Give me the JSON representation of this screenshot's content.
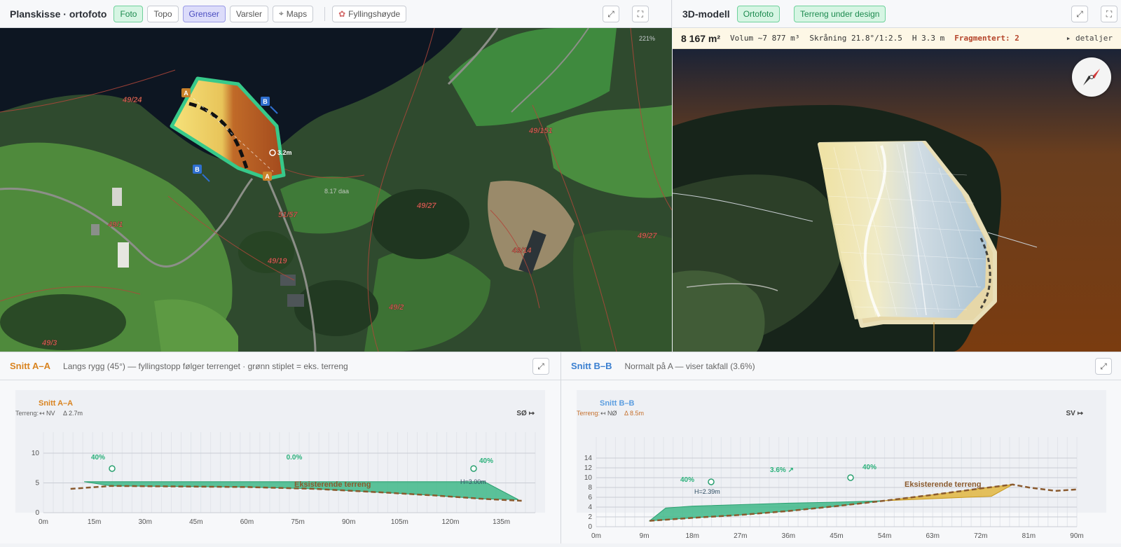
{
  "plan": {
    "title": "Planskisse · ortofoto",
    "chips": [
      "Foto",
      "Topo",
      "Grenser",
      "Varsler",
      "Maps"
    ],
    "fill_button": "Fyllingshøyde",
    "zoom": "221%",
    "area_label": "8.17 daa",
    "height_marker": "3.2m",
    "parcels": [
      "49/24",
      "49/151",
      "51/57",
      "49/27",
      "49/1",
      "49/19",
      "49/14",
      "49/27",
      "49/2",
      "49/3"
    ],
    "markers": {
      "a": "A",
      "b": "B"
    }
  },
  "model": {
    "title": "3D-modell",
    "chips": [
      "Ortofoto",
      "Terreng under design"
    ],
    "stats": {
      "area": "8 167 m²",
      "volume": "Volum ~7 877 m³",
      "slope": "Skråning 21.8°/1:2.5",
      "height": "H 3.3 m",
      "fragmented": "Fragmentert: 2",
      "details": "▸ detaljer"
    }
  },
  "section_a": {
    "title": "Snitt A–A",
    "subtitle": "Langs rygg (45°) — fyllingstopp følger terrenget · grønn stiplet = eks. terreng",
    "inner_title": "Snitt A–A",
    "terrain_label": "Terreng:",
    "terrain_dir": "↤ NV",
    "terrain_delta": "Δ 2.7m",
    "direction_right": "SØ ↦",
    "existing_label": "Eksisterende terreng",
    "height_label": "H=3.00m",
    "slope_labels": [
      "40%",
      "0.0%",
      "40%"
    ]
  },
  "section_b": {
    "title": "Snitt B–B",
    "subtitle": "Normalt på A — viser takfall (3.6%)",
    "inner_title": "Snitt B–B",
    "terrain_label": "Terreng:",
    "terrain_dir": "↤ NØ",
    "terrain_delta": "Δ 8.5m",
    "direction_right": "SV ↦",
    "existing_label": "Eksisterende terreng",
    "height_label": "H=2.39m",
    "slope_labels": [
      "40%",
      "3.6% ↗",
      "40%"
    ]
  },
  "chart_data": [
    {
      "type": "area",
      "title": "Snitt A–A",
      "x_ticks": [
        "0m",
        "15m",
        "30m",
        "45m",
        "60m",
        "75m",
        "90m",
        "105m",
        "120m",
        "135m"
      ],
      "y_ticks": [
        "0",
        "5",
        "10"
      ],
      "xlim": [
        0,
        145
      ],
      "ylim": [
        0,
        10
      ],
      "series": [
        {
          "name": "Eksisterende terreng",
          "x": [
            8,
            20,
            40,
            60,
            80,
            100,
            115,
            130,
            141
          ],
          "y": [
            4.0,
            4.5,
            4.4,
            4.3,
            4.0,
            3.4,
            2.9,
            2.3,
            2.0
          ]
        },
        {
          "x": [
            12,
            20,
            130,
            140
          ],
          "y": [
            5.2,
            5.2,
            5.2,
            2.2
          ]
        }
      ]
    },
    {
      "type": "area",
      "title": "Snitt B–B",
      "x_ticks": [
        "0m",
        "9m",
        "18m",
        "27m",
        "36m",
        "45m",
        "54m",
        "63m",
        "72m",
        "81m",
        "90m"
      ],
      "y_ticks": [
        "0",
        "2",
        "4",
        "6",
        "8",
        "10",
        "12",
        "14"
      ],
      "xlim": [
        0,
        90
      ],
      "ylim": [
        0,
        14
      ],
      "series": [
        {
          "name": "Eksisterende terreng",
          "x": [
            10,
            18,
            27,
            36,
            45,
            54,
            63,
            72,
            78,
            81,
            86,
            90
          ],
          "y": [
            1.2,
            1.8,
            2.4,
            3.2,
            4.2,
            5.3,
            6.5,
            7.8,
            8.6,
            8.0,
            7.3,
            7.6
          ]
        },
        {
          "x": [
            10,
            13,
            18,
            27,
            36,
            45,
            54
          ],
          "y": [
            1.2,
            3.8,
            4.2,
            4.5,
            4.8,
            5.0,
            5.3
          ]
        }
      ]
    }
  ]
}
